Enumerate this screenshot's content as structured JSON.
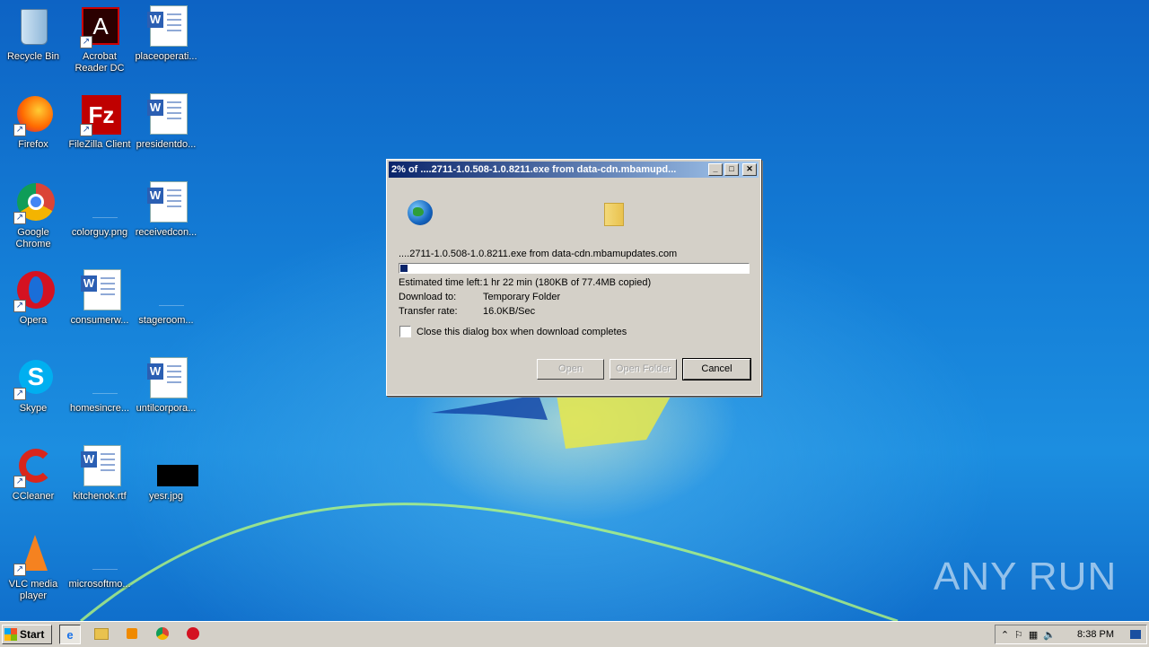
{
  "desktop": {
    "icons": [
      {
        "label": "Recycle Bin"
      },
      {
        "label": "Acrobat Reader DC"
      },
      {
        "label": "placeoperati..."
      },
      {
        "label": "Firefox"
      },
      {
        "label": "FileZilla Client"
      },
      {
        "label": "presidentdo..."
      },
      {
        "label": "Google Chrome"
      },
      {
        "label": "colorguy.png"
      },
      {
        "label": "receivedcon..."
      },
      {
        "label": "Opera"
      },
      {
        "label": "consumerw..."
      },
      {
        "label": "stageroom..."
      },
      {
        "label": "Skype"
      },
      {
        "label": "homesincre..."
      },
      {
        "label": "untilcorpora..."
      },
      {
        "label": "CCleaner"
      },
      {
        "label": "kitchenok.rtf"
      },
      {
        "label": "yesr.jpg"
      },
      {
        "label": "VLC media player"
      },
      {
        "label": "microsoftmo..."
      }
    ]
  },
  "dialog": {
    "title": "2% of ....2711-1.0.508-1.0.8211.exe from data-cdn.mbamupd...",
    "file_from": "....2711-1.0.508-1.0.8211.exe from data-cdn.mbamupdates.com",
    "progress_fraction": 0.02,
    "estimated_label": "Estimated time left:",
    "estimated_value": "1 hr 22 min (180KB of 77.4MB copied)",
    "download_to_label": "Download to:",
    "download_to_value": "Temporary Folder",
    "transfer_label": "Transfer rate:",
    "transfer_value": "16.0KB/Sec",
    "close_checkbox_label": "Close this dialog box when download completes",
    "open_button": "Open",
    "open_folder_button": "Open Folder",
    "cancel_button": "Cancel"
  },
  "watermark": "ANY RUN",
  "taskbar": {
    "start_label": "Start",
    "time": "8:38 PM"
  }
}
